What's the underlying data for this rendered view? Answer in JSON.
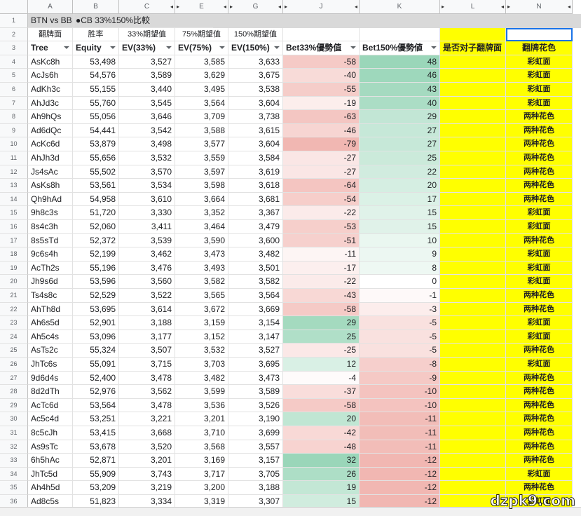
{
  "columns": [
    {
      "letter": "A"
    },
    {
      "letter": "B"
    },
    {
      "letter": "C"
    },
    {
      "letter": "E"
    },
    {
      "letter": "G"
    },
    {
      "letter": "J"
    },
    {
      "letter": "K"
    },
    {
      "letter": "L"
    },
    {
      "letter": "N"
    }
  ],
  "row1": {
    "a": "BTN vs BB",
    "b": "●CB 33%150%比較"
  },
  "row2": {
    "a": "翻牌面",
    "b": "胜率",
    "c": "33%期望值",
    "e": "75%期望值",
    "g": "150%期望值"
  },
  "row3": {
    "a": "Tree",
    "b": "Equity",
    "c": "EV(33%)",
    "e": "EV(75%)",
    "g": "EV(150%)",
    "j": "Bet33%優勢值",
    "k": "Bet150%優勢値",
    "l": "是否对子翻牌面",
    "n": "翻牌花色"
  },
  "filter_icon": "filter-icon",
  "rows": [
    {
      "n": "4",
      "tree": "AsKc8h",
      "equity": "53,498",
      "ev33": "3,527",
      "ev75": "3,585",
      "ev150": "3,633",
      "bet33": -58,
      "bet150": 48,
      "suit": "彩虹面"
    },
    {
      "n": "5",
      "tree": "AcJs6h",
      "equity": "54,576",
      "ev33": "3,589",
      "ev75": "3,629",
      "ev150": "3,675",
      "bet33": -40,
      "bet150": 46,
      "suit": "彩虹面"
    },
    {
      "n": "6",
      "tree": "AdKh3c",
      "equity": "55,155",
      "ev33": "3,440",
      "ev75": "3,495",
      "ev150": "3,538",
      "bet33": -55,
      "bet150": 43,
      "suit": "彩虹面"
    },
    {
      "n": "7",
      "tree": "AhJd3c",
      "equity": "55,760",
      "ev33": "3,545",
      "ev75": "3,564",
      "ev150": "3,604",
      "bet33": -19,
      "bet150": 40,
      "suit": "彩虹面"
    },
    {
      "n": "8",
      "tree": "Ah9hQs",
      "equity": "55,056",
      "ev33": "3,646",
      "ev75": "3,709",
      "ev150": "3,738",
      "bet33": -63,
      "bet150": 29,
      "suit": "两种花色"
    },
    {
      "n": "9",
      "tree": "Ad6dQc",
      "equity": "54,441",
      "ev33": "3,542",
      "ev75": "3,588",
      "ev150": "3,615",
      "bet33": -46,
      "bet150": 27,
      "suit": "两种花色"
    },
    {
      "n": "10",
      "tree": "AcKc6d",
      "equity": "53,879",
      "ev33": "3,498",
      "ev75": "3,577",
      "ev150": "3,604",
      "bet33": -79,
      "bet150": 27,
      "suit": "两种花色"
    },
    {
      "n": "11",
      "tree": "AhJh3d",
      "equity": "55,656",
      "ev33": "3,532",
      "ev75": "3,559",
      "ev150": "3,584",
      "bet33": -27,
      "bet150": 25,
      "suit": "两种花色"
    },
    {
      "n": "12",
      "tree": "Js4sAc",
      "equity": "55,502",
      "ev33": "3,570",
      "ev75": "3,597",
      "ev150": "3,619",
      "bet33": -27,
      "bet150": 22,
      "suit": "两种花色"
    },
    {
      "n": "13",
      "tree": "AsKs8h",
      "equity": "53,561",
      "ev33": "3,534",
      "ev75": "3,598",
      "ev150": "3,618",
      "bet33": -64,
      "bet150": 20,
      "suit": "两种花色"
    },
    {
      "n": "14",
      "tree": "Qh9hAd",
      "equity": "54,958",
      "ev33": "3,610",
      "ev75": "3,664",
      "ev150": "3,681",
      "bet33": -54,
      "bet150": 17,
      "suit": "两种花色"
    },
    {
      "n": "15",
      "tree": "9h8c3s",
      "equity": "51,720",
      "ev33": "3,330",
      "ev75": "3,352",
      "ev150": "3,367",
      "bet33": -22,
      "bet150": 15,
      "suit": "彩虹面"
    },
    {
      "n": "16",
      "tree": "8s4c3h",
      "equity": "52,060",
      "ev33": "3,411",
      "ev75": "3,464",
      "ev150": "3,479",
      "bet33": -53,
      "bet150": 15,
      "suit": "彩虹面"
    },
    {
      "n": "17",
      "tree": "8s5sTd",
      "equity": "52,372",
      "ev33": "3,539",
      "ev75": "3,590",
      "ev150": "3,600",
      "bet33": -51,
      "bet150": 10,
      "suit": "两种花色"
    },
    {
      "n": "18",
      "tree": "9c6s4h",
      "equity": "52,199",
      "ev33": "3,462",
      "ev75": "3,473",
      "ev150": "3,482",
      "bet33": -11,
      "bet150": 9,
      "suit": "彩虹面"
    },
    {
      "n": "19",
      "tree": "AcTh2s",
      "equity": "55,196",
      "ev33": "3,476",
      "ev75": "3,493",
      "ev150": "3,501",
      "bet33": -17,
      "bet150": 8,
      "suit": "彩虹面"
    },
    {
      "n": "20",
      "tree": "Jh9s6d",
      "equity": "53,596",
      "ev33": "3,560",
      "ev75": "3,582",
      "ev150": "3,582",
      "bet33": -22,
      "bet150": 0,
      "suit": "彩虹面"
    },
    {
      "n": "21",
      "tree": "Ts4s8c",
      "equity": "52,529",
      "ev33": "3,522",
      "ev75": "3,565",
      "ev150": "3,564",
      "bet33": -43,
      "bet150": -1,
      "suit": "两种花色"
    },
    {
      "n": "22",
      "tree": "AhTh8d",
      "equity": "53,695",
      "ev33": "3,614",
      "ev75": "3,672",
      "ev150": "3,669",
      "bet33": -58,
      "bet150": -3,
      "suit": "两种花色"
    },
    {
      "n": "23",
      "tree": "Ah6s5d",
      "equity": "52,901",
      "ev33": "3,188",
      "ev75": "3,159",
      "ev150": "3,154",
      "bet33": 29,
      "bet150": -5,
      "suit": "彩虹面"
    },
    {
      "n": "24",
      "tree": "Ah5c4s",
      "equity": "53,096",
      "ev33": "3,177",
      "ev75": "3,152",
      "ev150": "3,147",
      "bet33": 25,
      "bet150": -5,
      "suit": "彩虹面"
    },
    {
      "n": "25",
      "tree": "AsTs2c",
      "equity": "55,324",
      "ev33": "3,507",
      "ev75": "3,532",
      "ev150": "3,527",
      "bet33": -25,
      "bet150": -5,
      "suit": "两种花色"
    },
    {
      "n": "26",
      "tree": "JhTc6s",
      "equity": "55,091",
      "ev33": "3,715",
      "ev75": "3,703",
      "ev150": "3,695",
      "bet33": 12,
      "bet150": -8,
      "suit": "彩虹面"
    },
    {
      "n": "27",
      "tree": "9d6d4s",
      "equity": "52,400",
      "ev33": "3,478",
      "ev75": "3,482",
      "ev150": "3,473",
      "bet33": -4,
      "bet150": -9,
      "suit": "两种花色"
    },
    {
      "n": "28",
      "tree": "8d2dTh",
      "equity": "52,976",
      "ev33": "3,562",
      "ev75": "3,599",
      "ev150": "3,589",
      "bet33": -37,
      "bet150": -10,
      "suit": "两种花色"
    },
    {
      "n": "29",
      "tree": "AcTc6d",
      "equity": "53,564",
      "ev33": "3,478",
      "ev75": "3,536",
      "ev150": "3,526",
      "bet33": -58,
      "bet150": -10,
      "suit": "两种花色"
    },
    {
      "n": "30",
      "tree": "Ac5c4d",
      "equity": "53,251",
      "ev33": "3,221",
      "ev75": "3,201",
      "ev150": "3,190",
      "bet33": 20,
      "bet150": -11,
      "suit": "两种花色"
    },
    {
      "n": "31",
      "tree": "8c5cJh",
      "equity": "53,415",
      "ev33": "3,668",
      "ev75": "3,710",
      "ev150": "3,699",
      "bet33": -42,
      "bet150": -11,
      "suit": "两种花色"
    },
    {
      "n": "32",
      "tree": "As9sTc",
      "equity": "53,678",
      "ev33": "3,520",
      "ev75": "3,568",
      "ev150": "3,557",
      "bet33": -48,
      "bet150": -11,
      "suit": "两种花色"
    },
    {
      "n": "33",
      "tree": "6h5hAc",
      "equity": "52,871",
      "ev33": "3,201",
      "ev75": "3,169",
      "ev150": "3,157",
      "bet33": 32,
      "bet150": -12,
      "suit": "两种花色"
    },
    {
      "n": "34",
      "tree": "JhTc5d",
      "equity": "55,909",
      "ev33": "3,743",
      "ev75": "3,717",
      "ev150": "3,705",
      "bet33": 26,
      "bet150": -12,
      "suit": "彩虹面"
    },
    {
      "n": "35",
      "tree": "Ah4h5d",
      "equity": "53,209",
      "ev33": "3,219",
      "ev75": "3,200",
      "ev150": "3,188",
      "bet33": 19,
      "bet150": -12,
      "suit": "两种花色"
    },
    {
      "n": "36",
      "tree": "Ad8c5s",
      "equity": "51,823",
      "ev33": "3,334",
      "ev75": "3,319",
      "ev150": "3,307",
      "bet33": 15,
      "bet150": -12,
      "suit": "彩虹面"
    }
  ],
  "watermark": "dzpk9.com",
  "colors": {
    "yellow": "#ffff00",
    "red": "#e67c73",
    "green": "#57bb8a",
    "header_bg": "#f8f9fa",
    "row1_bg": "#d9d9d9",
    "selection": "#1a73e8"
  }
}
